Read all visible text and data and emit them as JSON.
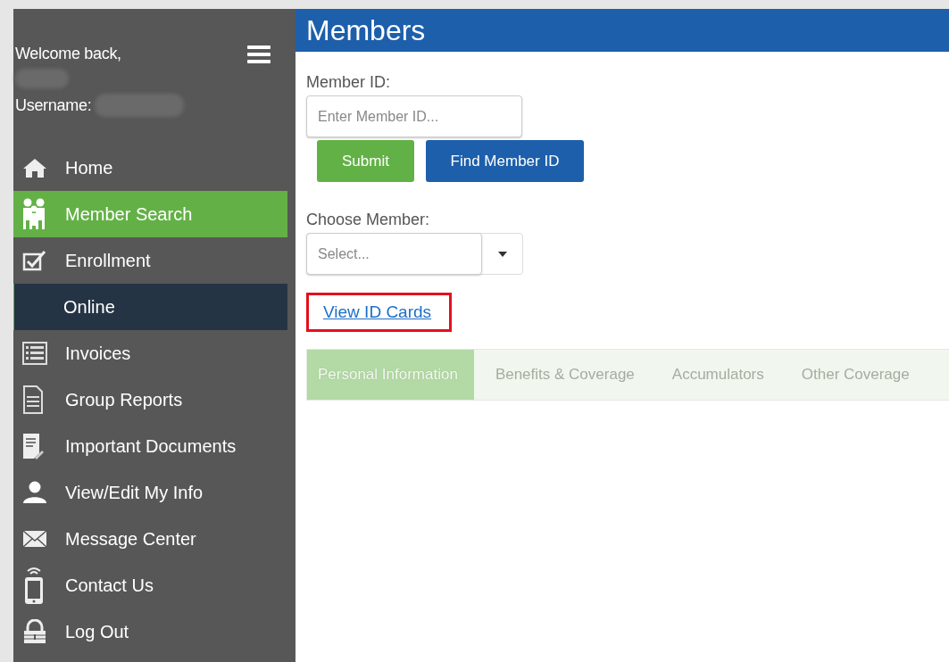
{
  "sidebar": {
    "welcome": "Welcome back,",
    "username_label": "Username:",
    "items": [
      {
        "label": "Home",
        "kind": "item",
        "selected": false
      },
      {
        "label": "Member Search",
        "kind": "item",
        "selected": true
      },
      {
        "label": "Enrollment",
        "kind": "item",
        "selected": false
      },
      {
        "label": "Online",
        "kind": "subitem",
        "selected": false
      },
      {
        "label": "Invoices",
        "kind": "item",
        "selected": false
      },
      {
        "label": "Group Reports",
        "kind": "item",
        "selected": false
      },
      {
        "label": "Important Documents",
        "kind": "item",
        "selected": false
      },
      {
        "label": "View/Edit My Info",
        "kind": "item",
        "selected": false
      },
      {
        "label": "Message Center",
        "kind": "item",
        "selected": false
      },
      {
        "label": "Contact Us",
        "kind": "item",
        "selected": false
      },
      {
        "label": "Log Out",
        "kind": "item",
        "selected": false
      }
    ]
  },
  "header": {
    "title": "Members"
  },
  "member_id": {
    "label": "Member ID:",
    "placeholder": "Enter Member ID..."
  },
  "buttons": [
    {
      "label": "Submit",
      "kind": "primary"
    },
    {
      "label": "Find Member ID",
      "kind": "secondary"
    }
  ],
  "choose_member": {
    "label": "Choose Member:",
    "placeholder": "Select..."
  },
  "link": {
    "label": "View ID Cards",
    "highlighted": true
  },
  "tabs": {
    "disabled": true,
    "items": [
      {
        "label": "Personal Information",
        "selected": true
      },
      {
        "label": "Benefits & Coverage",
        "selected": false
      },
      {
        "label": "Accumulators",
        "selected": false
      },
      {
        "label": "Other Coverage",
        "selected": false
      }
    ]
  }
}
